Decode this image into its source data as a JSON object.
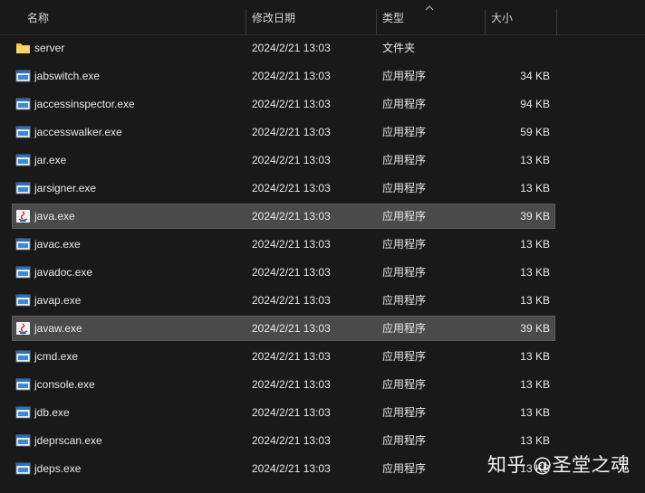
{
  "columns": {
    "name": "名称",
    "date": "修改日期",
    "type": "类型",
    "size": "大小"
  },
  "sort": {
    "column": "type",
    "direction": "ascending",
    "icon": "chevron-up-icon"
  },
  "colors": {
    "background": "#191919",
    "selection": "#4a4a4a",
    "folder": "#f2c14a",
    "exe_icon_blue": "#2b6fc0"
  },
  "files": [
    {
      "name": "server",
      "date": "2024/2/21 13:03",
      "type": "文件夹",
      "size": "",
      "icon": "folder-icon",
      "selected": false
    },
    {
      "name": "jabswitch.exe",
      "date": "2024/2/21 13:03",
      "type": "应用程序",
      "size": "34 KB",
      "icon": "exe-icon",
      "selected": false
    },
    {
      "name": "jaccessinspector.exe",
      "date": "2024/2/21 13:03",
      "type": "应用程序",
      "size": "94 KB",
      "icon": "exe-icon",
      "selected": false
    },
    {
      "name": "jaccesswalker.exe",
      "date": "2024/2/21 13:03",
      "type": "应用程序",
      "size": "59 KB",
      "icon": "exe-icon",
      "selected": false
    },
    {
      "name": "jar.exe",
      "date": "2024/2/21 13:03",
      "type": "应用程序",
      "size": "13 KB",
      "icon": "exe-icon",
      "selected": false
    },
    {
      "name": "jarsigner.exe",
      "date": "2024/2/21 13:03",
      "type": "应用程序",
      "size": "13 KB",
      "icon": "exe-icon",
      "selected": false
    },
    {
      "name": "java.exe",
      "date": "2024/2/21 13:03",
      "type": "应用程序",
      "size": "39 KB",
      "icon": "java-icon",
      "selected": true
    },
    {
      "name": "javac.exe",
      "date": "2024/2/21 13:03",
      "type": "应用程序",
      "size": "13 KB",
      "icon": "exe-icon",
      "selected": false
    },
    {
      "name": "javadoc.exe",
      "date": "2024/2/21 13:03",
      "type": "应用程序",
      "size": "13 KB",
      "icon": "exe-icon",
      "selected": false
    },
    {
      "name": "javap.exe",
      "date": "2024/2/21 13:03",
      "type": "应用程序",
      "size": "13 KB",
      "icon": "exe-icon",
      "selected": false
    },
    {
      "name": "javaw.exe",
      "date": "2024/2/21 13:03",
      "type": "应用程序",
      "size": "39 KB",
      "icon": "java-icon",
      "selected": true
    },
    {
      "name": "jcmd.exe",
      "date": "2024/2/21 13:03",
      "type": "应用程序",
      "size": "13 KB",
      "icon": "exe-icon",
      "selected": false
    },
    {
      "name": "jconsole.exe",
      "date": "2024/2/21 13:03",
      "type": "应用程序",
      "size": "13 KB",
      "icon": "exe-icon",
      "selected": false
    },
    {
      "name": "jdb.exe",
      "date": "2024/2/21 13:03",
      "type": "应用程序",
      "size": "13 KB",
      "icon": "exe-icon",
      "selected": false
    },
    {
      "name": "jdeprscan.exe",
      "date": "2024/2/21 13:03",
      "type": "应用程序",
      "size": "13 KB",
      "icon": "exe-icon",
      "selected": false
    },
    {
      "name": "jdeps.exe",
      "date": "2024/2/21 13:03",
      "type": "应用程序",
      "size": "13 KB",
      "icon": "exe-icon",
      "selected": false
    }
  ],
  "watermark": "知乎 @圣堂之魂"
}
